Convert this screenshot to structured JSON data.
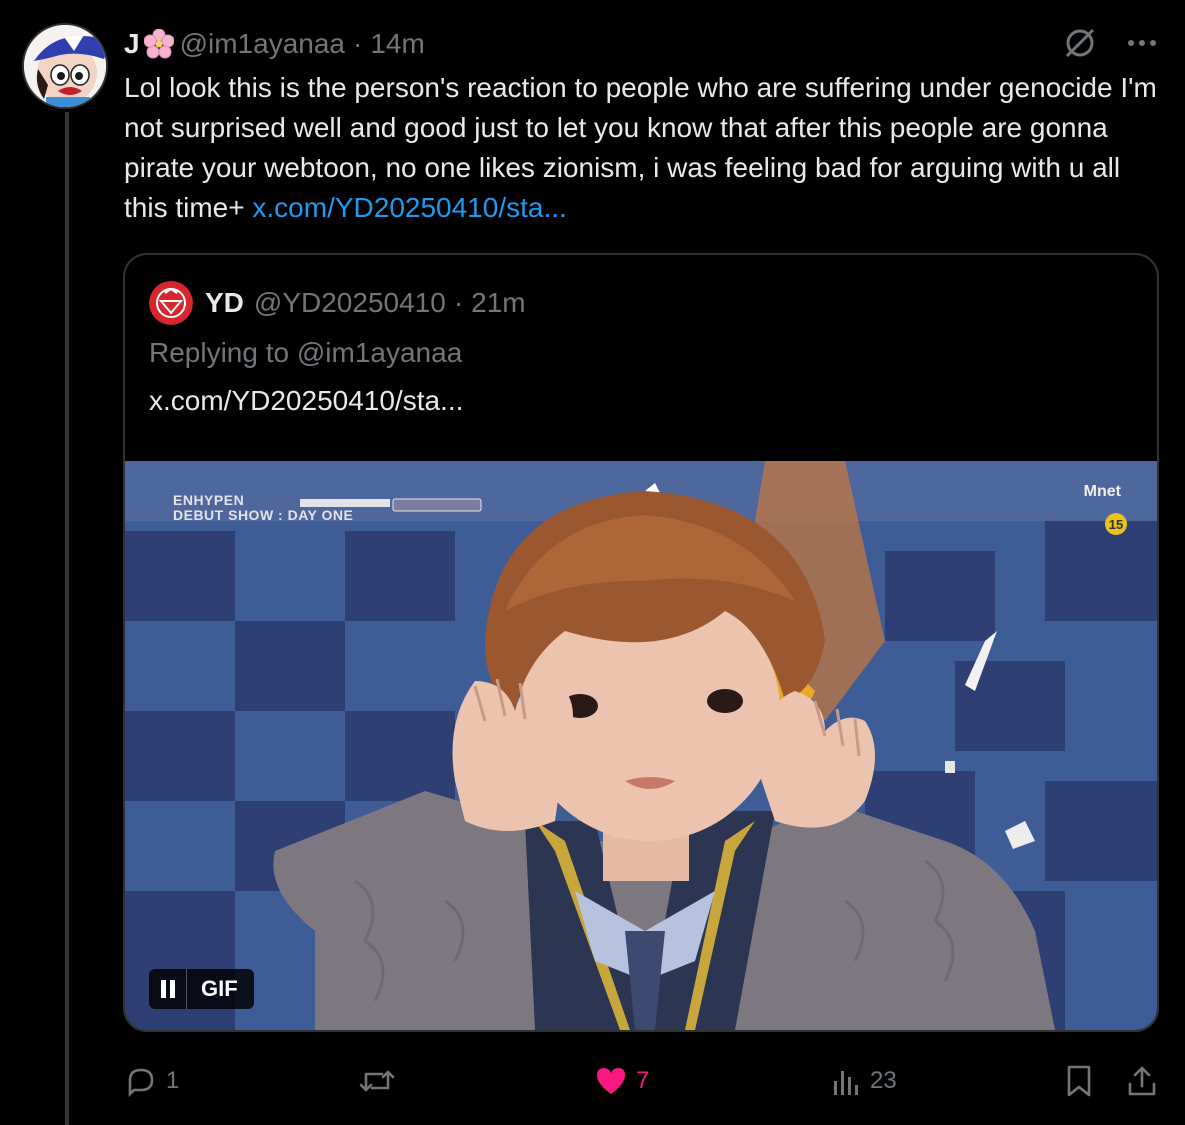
{
  "tweet": {
    "display_name": "J",
    "name_emoji_icon": "cherry-blossom-icon",
    "handle": "@im1ayanaa",
    "separator": "·",
    "time": "14m",
    "body_text": "Lol look this is the person's reaction to people who are suffering under genocide I'm not surprised well and good just to let you know that after this people are gonna pirate your webtoon, no one likes zionism, i was feeling bad for arguing with u all this time+ ",
    "body_link": "x.com/YD20250410/sta...",
    "link_color": "#1d9bf0"
  },
  "quote": {
    "display_name": "YD",
    "handle": "@YD20250410",
    "separator": "·",
    "time": "21m",
    "replying_to": "Replying to @im1ayanaa",
    "link_text": "x.com/YD20250410/sta...",
    "media": {
      "overlay_title_line1": "ENHYPEN",
      "overlay_title_line2": "DEBUT SHOW : DAY ONE",
      "channel_logo": "Mnet",
      "age_rating": "15",
      "gif_label": "GIF"
    }
  },
  "actions": {
    "replies": "1",
    "reposts": "",
    "likes": "7",
    "views": "23",
    "like_color": "#f91880"
  }
}
